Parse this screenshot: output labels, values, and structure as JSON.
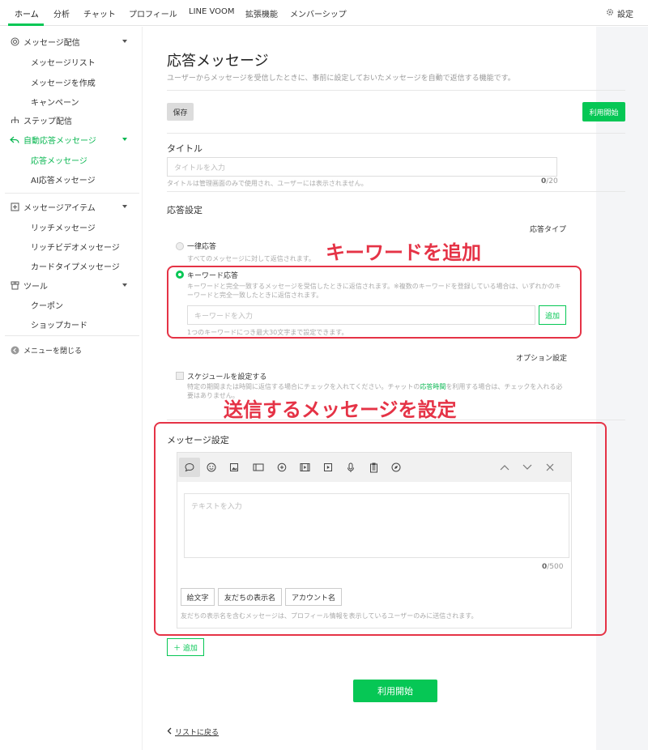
{
  "topnav": {
    "tabs": [
      "ホーム",
      "分析",
      "チャット",
      "プロフィール",
      "LINE VOOM",
      "拡張機能",
      "メンバーシップ"
    ],
    "settings_label": "設定"
  },
  "sidebar": {
    "message_delivery": "メッセージ配信",
    "message_list": "メッセージリスト",
    "create_message": "メッセージを作成",
    "campaign": "キャンペーン",
    "step_delivery": "ステップ配信",
    "auto_reply": "自動応答メッセージ",
    "reply_message": "応答メッセージ",
    "ai_reply": "AI応答メッセージ",
    "message_items": "メッセージアイテム",
    "rich_message": "リッチメッセージ",
    "rich_video": "リッチビデオメッセージ",
    "card_message": "カードタイプメッセージ",
    "tools": "ツール",
    "coupon": "クーポン",
    "shop_card": "ショップカード",
    "close_menu": "メニューを閉じる"
  },
  "main": {
    "title": "応答メッセージ",
    "description": "ユーザーからメッセージを受信したときに、事前に設定しておいたメッセージを自動で返信する機能です。",
    "save_label": "保存",
    "start_label": "利用開始",
    "title_section": "タイトル",
    "title_placeholder": "タイトルを入力",
    "title_hint": "タイトルは管理画面のみで使用され、ユーザーには表示されません。",
    "title_count": "0",
    "title_max": "/20",
    "reply_settings": "応答設定",
    "reply_type": "応答タイプ",
    "uniform_reply": "一律応答",
    "uniform_desc": "すべてのメッセージに対して返信されます。",
    "keyword_reply": "キーワード応答",
    "keyword_desc": "キーワードと完全一致するメッセージを受信したときに返信されます。※複数のキーワードを登録している場合は、いずれかのキーワードと完全一致したときに返信されます。",
    "keyword_placeholder": "キーワードを入力",
    "add_label": "追加",
    "keyword_hint": "1つのキーワードにつき最大30文字まで設定できます。",
    "option_settings": "オプション設定",
    "schedule_label": "スケジュールを設定する",
    "schedule_desc_1": "特定の期間または時間に返信する場合にチェックを入れてください。チャットの",
    "schedule_link": "応答時間",
    "schedule_desc_2": "を利用する場合は、チェックを入れる必要はありません。",
    "message_settings": "メッセージ設定",
    "text_placeholder": "テキストを入力",
    "text_count": "0",
    "text_max": "/500",
    "emoji_label": "絵文字",
    "friend_name_label": "友だちの表示名",
    "account_name_label": "アカウント名",
    "friend_name_hint": "友だちの表示名を含むメッセージは、プロフィール情報を表示しているユーザーのみに送信されます。",
    "add_more_label": "＋ 追加",
    "back_label": "リストに戻る"
  },
  "annotations": {
    "add_keyword": "キーワードを追加",
    "set_message": "送信するメッセージを設定"
  },
  "colors": {
    "accent": "#06c755",
    "annotation": "#e53346"
  }
}
